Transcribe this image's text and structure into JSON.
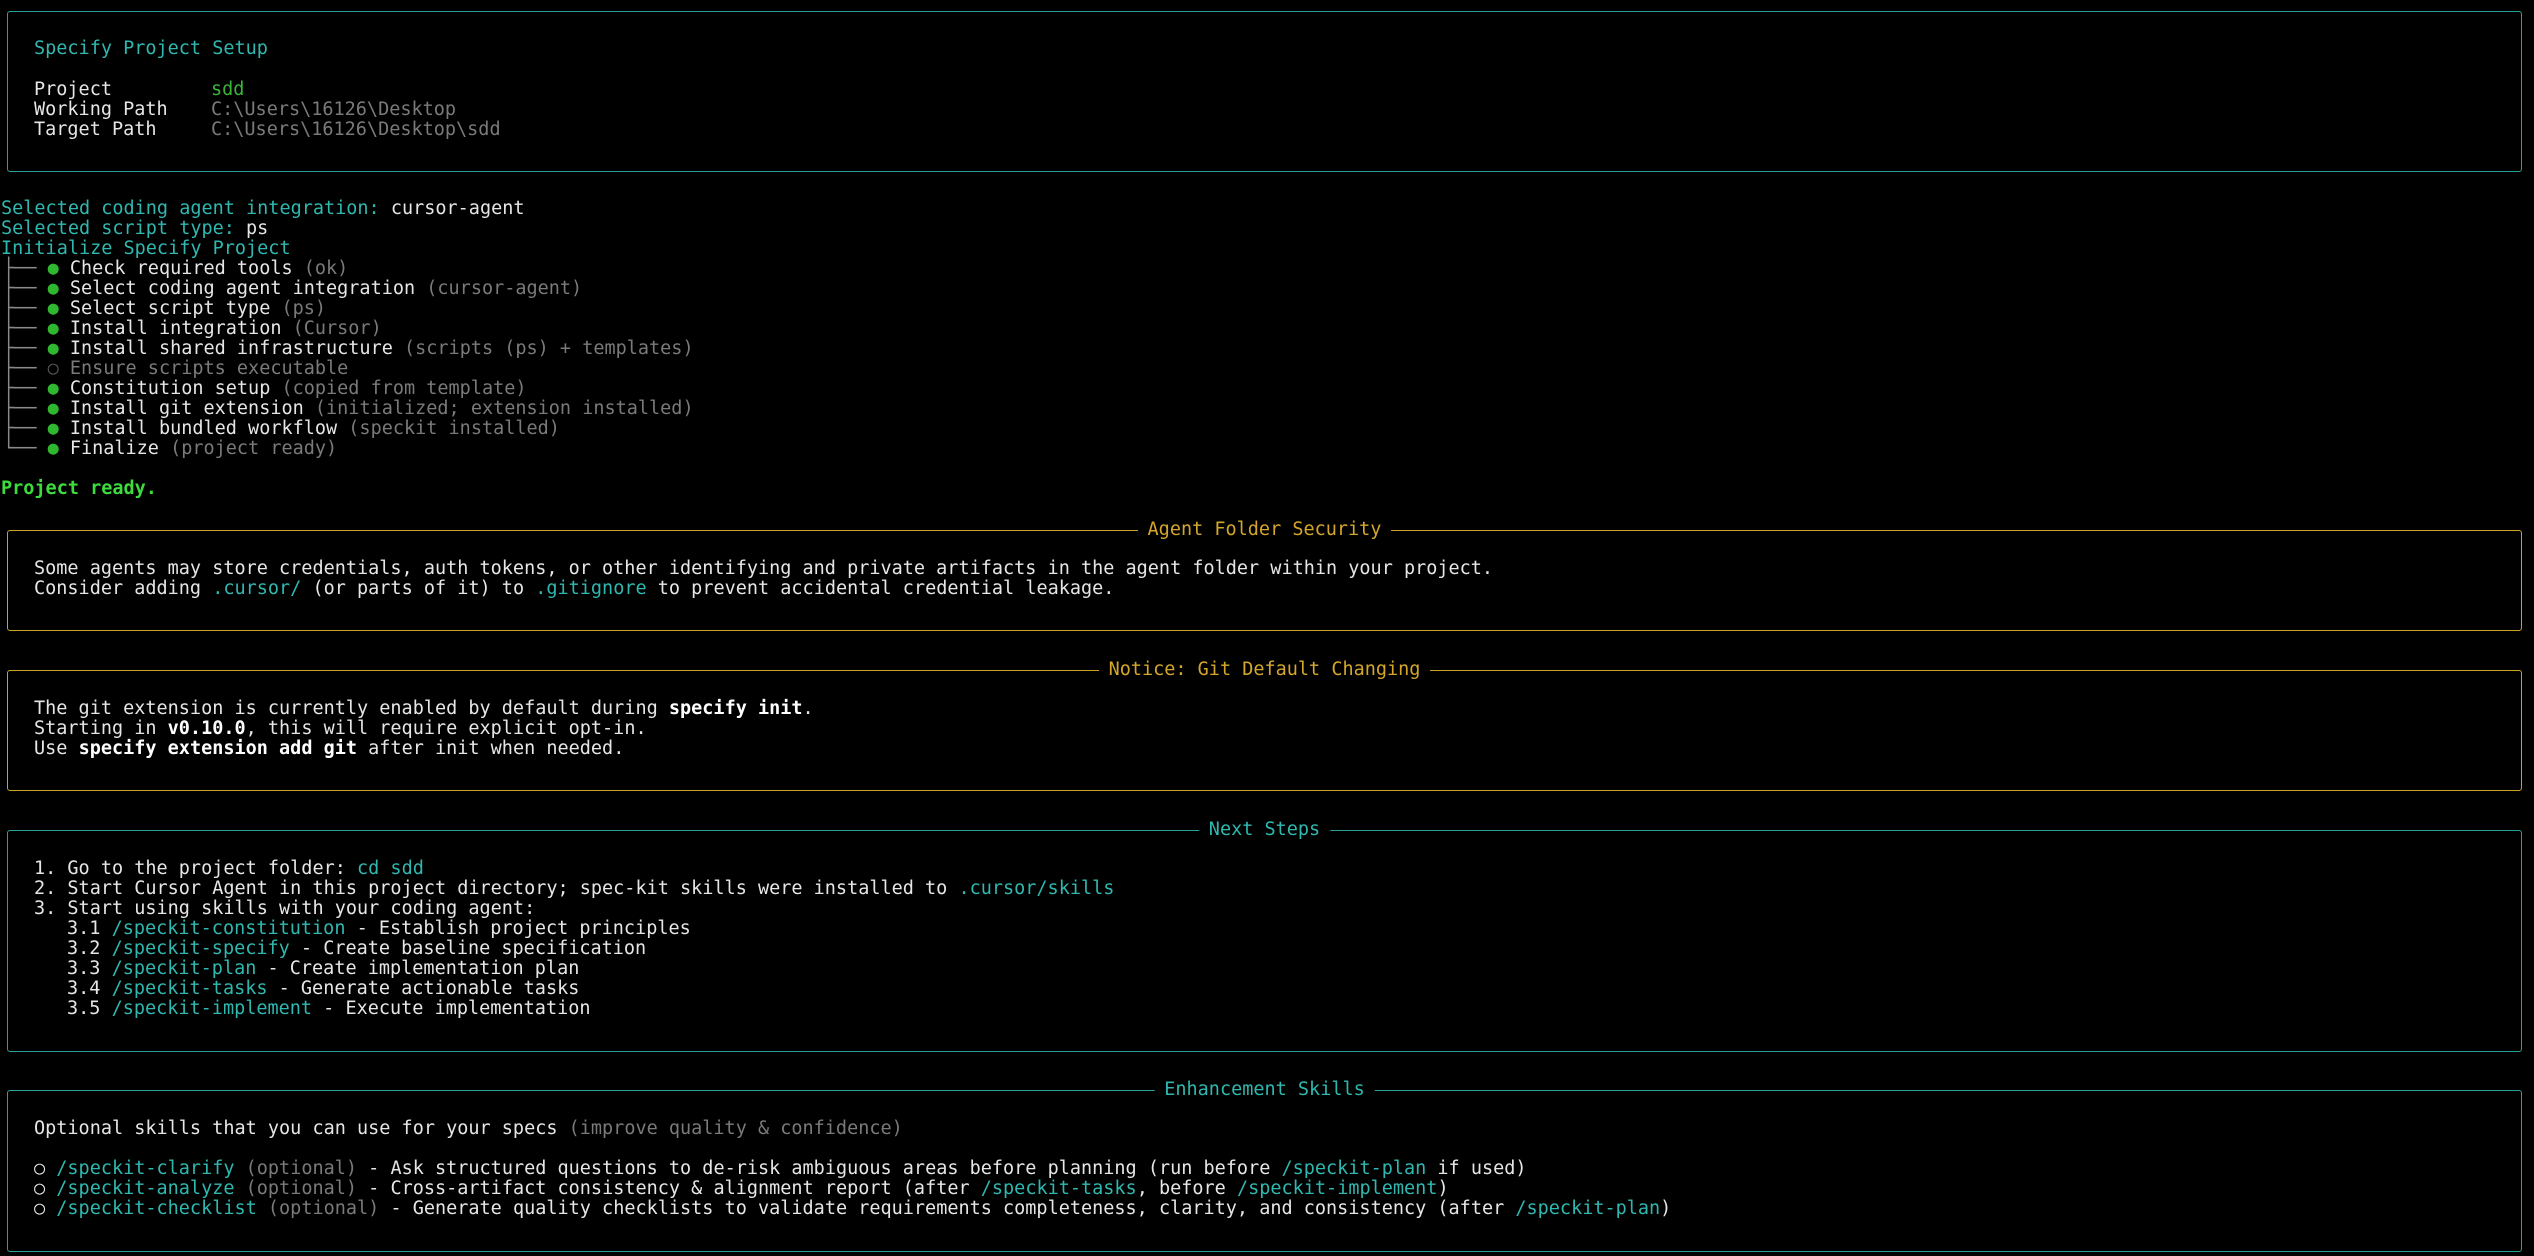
{
  "colors": {
    "panel_border_cyan": "#2aa198",
    "panel_border_yellow": "#c9a227",
    "accent_cyan": "#2fb8b0",
    "accent_green": "#3ab53a",
    "accent_yellow": "#d4a72c"
  },
  "setup_panel": {
    "title": "Specify Project Setup",
    "rows": [
      {
        "label": "Project",
        "value": "sdd"
      },
      {
        "label": "Working Path",
        "value": "C:\\Users\\16126\\Desktop"
      },
      {
        "label": "Target Path",
        "value": "C:\\Users\\16126\\Desktop\\sdd"
      }
    ]
  },
  "selection": {
    "agent_label": "Selected coding agent integration:",
    "agent_value": "cursor-agent",
    "script_label": "Selected script type:",
    "script_value": "ps",
    "init_title": "Initialize Specify Project"
  },
  "tree_branch": "├──",
  "tree_last": "└──",
  "bullet_done": "●",
  "bullet_skip": "○",
  "steps": [
    {
      "label": "Check required tools",
      "detail": "(ok)",
      "done": true
    },
    {
      "label": "Select coding agent integration",
      "detail": "(cursor-agent)",
      "done": true
    },
    {
      "label": "Select script type",
      "detail": "(ps)",
      "done": true
    },
    {
      "label": "Install integration",
      "detail": "(Cursor)",
      "done": true
    },
    {
      "label": "Install shared infrastructure",
      "detail": "(scripts (ps) + templates)",
      "done": true
    },
    {
      "label": "Ensure scripts executable",
      "detail": "",
      "done": false
    },
    {
      "label": "Constitution setup",
      "detail": "(copied from template)",
      "done": true
    },
    {
      "label": "Install git extension",
      "detail": "(initialized; extension installed)",
      "done": true
    },
    {
      "label": "Install bundled workflow",
      "detail": "(speckit installed)",
      "done": true
    },
    {
      "label": "Finalize",
      "detail": "(project ready)",
      "done": true
    }
  ],
  "project_ready": "Project ready.",
  "security_panel": {
    "title": "Agent Folder Security",
    "line1": "Some agents may store credentials, auth tokens, or other identifying and private artifacts in the agent folder within your project.",
    "line2_a": "Consider adding ",
    "line2_folder": ".cursor/",
    "line2_b": " (or parts of it) to ",
    "line2_gitignore": ".gitignore",
    "line2_c": " to prevent accidental credential leakage."
  },
  "notice_panel": {
    "title": "Notice: Git Default Changing",
    "l1_a": "The git extension is currently enabled by default during ",
    "l1_bold": "specify init",
    "l1_b": ".",
    "l2_a": "Starting in ",
    "l2_bold": "v0.10.0",
    "l2_b": ", this will require explicit opt-in.",
    "l3_a": "Use ",
    "l3_bold": "specify extension add git",
    "l3_b": " after init when needed."
  },
  "next_steps_panel": {
    "title": "Next Steps",
    "s1_a": "1. Go to the project folder: ",
    "s1_cmd": "cd sdd",
    "s2_a": "2. Start Cursor Agent in this project directory; spec-kit skills were installed to ",
    "s2_path": ".cursor/skills",
    "s3": "3. Start using skills with your coding agent:",
    "sub": [
      {
        "num": "3.1",
        "cmd": "/speckit-constitution",
        "desc": " - Establish project principles"
      },
      {
        "num": "3.2",
        "cmd": "/speckit-specify",
        "desc": " - Create baseline specification"
      },
      {
        "num": "3.3",
        "cmd": "/speckit-plan",
        "desc": " - Create implementation plan"
      },
      {
        "num": "3.4",
        "cmd": "/speckit-tasks",
        "desc": " - Generate actionable tasks"
      },
      {
        "num": "3.5",
        "cmd": "/speckit-implement",
        "desc": " - Execute implementation"
      }
    ]
  },
  "enhancement_panel": {
    "title": "Enhancement Skills",
    "intro": "Optional skills that you can use for your specs ",
    "intro_dim": "(improve quality & confidence)",
    "items": [
      {
        "bullet": "○",
        "cmd": "/speckit-clarify",
        "opt": "(optional)",
        "a": " - Ask structured questions to de-risk ambiguous areas before planning (run before ",
        "ref1": "/speckit-plan",
        "b": " if used)",
        "ref2": "",
        "c": ""
      },
      {
        "bullet": "○",
        "cmd": "/speckit-analyze",
        "opt": "(optional)",
        "a": " - Cross-artifact consistency & alignment report (after ",
        "ref1": "/speckit-tasks",
        "b": ", before ",
        "ref2": "/speckit-implement",
        "c": ")"
      },
      {
        "bullet": "○",
        "cmd": "/speckit-checklist",
        "opt": "(optional)",
        "a": " - Generate quality checklists to validate requirements completeness, clarity, and consistency (after ",
        "ref1": "/speckit-plan",
        "b": ")",
        "ref2": "",
        "c": ""
      }
    ]
  }
}
